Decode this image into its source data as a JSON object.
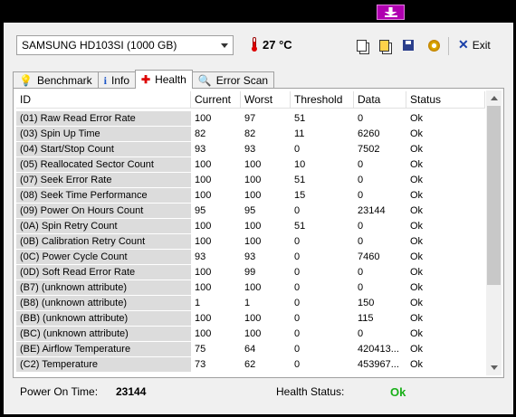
{
  "top_button_icon": "download-arrow-icon",
  "drive": {
    "selected": "SAMSUNG HD103SI (1000 GB)"
  },
  "temperature": {
    "value": "27 °C",
    "icon": "thermometer-icon"
  },
  "toolbar": {
    "exit_label": "Exit"
  },
  "tabs": [
    {
      "label": "Benchmark",
      "icon": "benchmark-icon"
    },
    {
      "label": "Info",
      "icon": "info-icon"
    },
    {
      "label": "Health",
      "icon": "health-cross-icon",
      "active": true
    },
    {
      "label": "Error Scan",
      "icon": "magnifier-icon"
    }
  ],
  "table": {
    "headers": [
      "ID",
      "Current",
      "Worst",
      "Threshold",
      "Data",
      "Status"
    ],
    "rows": [
      [
        "(01) Raw Read Error Rate",
        "100",
        "97",
        "51",
        "0",
        "Ok"
      ],
      [
        "(03) Spin Up Time",
        "82",
        "82",
        "11",
        "6260",
        "Ok"
      ],
      [
        "(04) Start/Stop Count",
        "93",
        "93",
        "0",
        "7502",
        "Ok"
      ],
      [
        "(05) Reallocated Sector Count",
        "100",
        "100",
        "10",
        "0",
        "Ok"
      ],
      [
        "(07) Seek Error Rate",
        "100",
        "100",
        "51",
        "0",
        "Ok"
      ],
      [
        "(08) Seek Time Performance",
        "100",
        "100",
        "15",
        "0",
        "Ok"
      ],
      [
        "(09) Power On Hours Count",
        "95",
        "95",
        "0",
        "23144",
        "Ok"
      ],
      [
        "(0A) Spin Retry Count",
        "100",
        "100",
        "51",
        "0",
        "Ok"
      ],
      [
        "(0B) Calibration Retry Count",
        "100",
        "100",
        "0",
        "0",
        "Ok"
      ],
      [
        "(0C) Power Cycle Count",
        "93",
        "93",
        "0",
        "7460",
        "Ok"
      ],
      [
        "(0D) Soft Read Error Rate",
        "100",
        "99",
        "0",
        "0",
        "Ok"
      ],
      [
        "(B7) (unknown attribute)",
        "100",
        "100",
        "0",
        "0",
        "Ok"
      ],
      [
        "(B8) (unknown attribute)",
        "1",
        "1",
        "0",
        "150",
        "Ok"
      ],
      [
        "(BB) (unknown attribute)",
        "100",
        "100",
        "0",
        "115",
        "Ok"
      ],
      [
        "(BC) (unknown attribute)",
        "100",
        "100",
        "0",
        "0",
        "Ok"
      ],
      [
        "(BE) Airflow Temperature",
        "75",
        "64",
        "0",
        "420413...",
        "Ok"
      ],
      [
        "(C2) Temperature",
        "73",
        "62",
        "0",
        "453967...",
        "Ok"
      ]
    ]
  },
  "status_bar": {
    "power_on_label": "Power On Time:",
    "power_on_value": "23144",
    "health_label": "Health Status:",
    "health_value": "Ok",
    "health_color": "#19b019"
  }
}
